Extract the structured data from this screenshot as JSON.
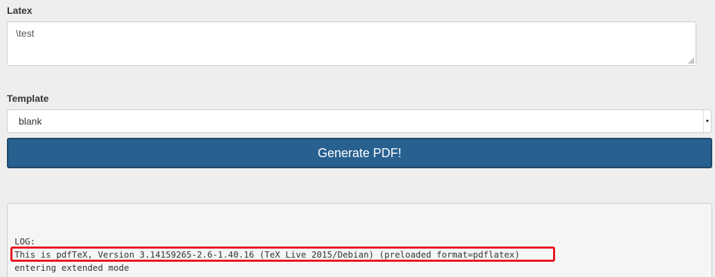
{
  "latex": {
    "label": "Latex",
    "value": "\\test"
  },
  "template": {
    "label": "Template",
    "selected": "blank"
  },
  "generate_button": {
    "label": "Generate PDF!"
  },
  "log": {
    "header": "LOG:",
    "lines": [
      "This is pdfTeX, Version 3.14159265-2.6-1.40.16 (TeX Live 2015/Debian) (preloaded format=pdflatex)",
      "entering extended mode"
    ],
    "highlight_color": "#e8131f"
  },
  "colors": {
    "background": "#eeeeee",
    "primary_button": "#286090"
  }
}
